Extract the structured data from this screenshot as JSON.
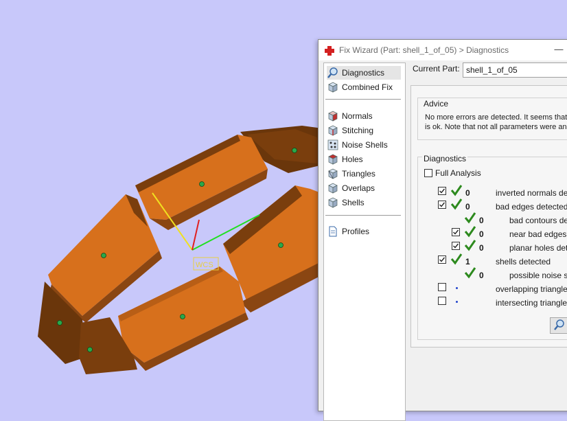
{
  "viewport": {
    "wcs_label": "WCS",
    "background_color": "#c8c8fa",
    "shell_color": "#e07a24",
    "shell_dark_color": "#7a3e0d"
  },
  "window": {
    "title": "Fix Wizard (Part: shell_1_of_05) > Diagnostics",
    "title_icon": "red-cross-icon",
    "minimize_glyph": "—"
  },
  "nav": {
    "items": [
      {
        "label": "Diagnostics",
        "icon": "magnifier-icon",
        "selected": true
      },
      {
        "label": "Combined Fix",
        "icon": "cube-icon"
      },
      {
        "label": "Normals",
        "icon": "normals-cube-icon"
      },
      {
        "label": "Stitching",
        "icon": "stitching-cube-icon"
      },
      {
        "label": "Noise Shells",
        "icon": "noise-shells-icon"
      },
      {
        "label": "Holes",
        "icon": "holes-cube-icon"
      },
      {
        "label": "Triangles",
        "icon": "triangles-icon"
      },
      {
        "label": "Overlaps",
        "icon": "overlaps-cube-icon"
      },
      {
        "label": "Shells",
        "icon": "shells-cube-icon"
      },
      {
        "label": "Profiles",
        "icon": "document-icon"
      }
    ]
  },
  "current_part": {
    "label": "Current Part:",
    "value": "shell_1_of_05"
  },
  "advice": {
    "title": "Advice",
    "line1": "No more errors are detected. It seems that",
    "line2": "is ok. Note that not all parameters were an"
  },
  "diagnostics": {
    "title": "Diagnostics",
    "full_analysis_label": "Full Analysis",
    "full_analysis_checked": false,
    "rows": [
      {
        "checked": true,
        "status": "ok",
        "count": "0",
        "label": "inverted normals detec"
      },
      {
        "checked": true,
        "status": "ok",
        "count": "0",
        "label": "bad edges detected"
      },
      {
        "checked": null,
        "status": "ok",
        "count": "0",
        "label": "bad contours dete"
      },
      {
        "checked": true,
        "status": "ok",
        "count": "0",
        "label": "near bad edges d"
      },
      {
        "checked": true,
        "status": "ok",
        "count": "0",
        "label": "planar holes detec"
      },
      {
        "checked": true,
        "status": "ok",
        "count": "1",
        "label": "shells detected"
      },
      {
        "checked": null,
        "status": "ok",
        "count": "0",
        "label": "possible noise she"
      },
      {
        "checked": false,
        "status": "unknown",
        "count": "",
        "label": "overlapping triangles d"
      },
      {
        "checked": false,
        "status": "unknown",
        "count": "",
        "label": "intersecting triangles d"
      }
    ],
    "search_icon": "magnifier-icon"
  },
  "colors": {
    "check_green": "#2d8a1e",
    "accent_blue": "#2244cc",
    "title_red": "#d42020"
  }
}
